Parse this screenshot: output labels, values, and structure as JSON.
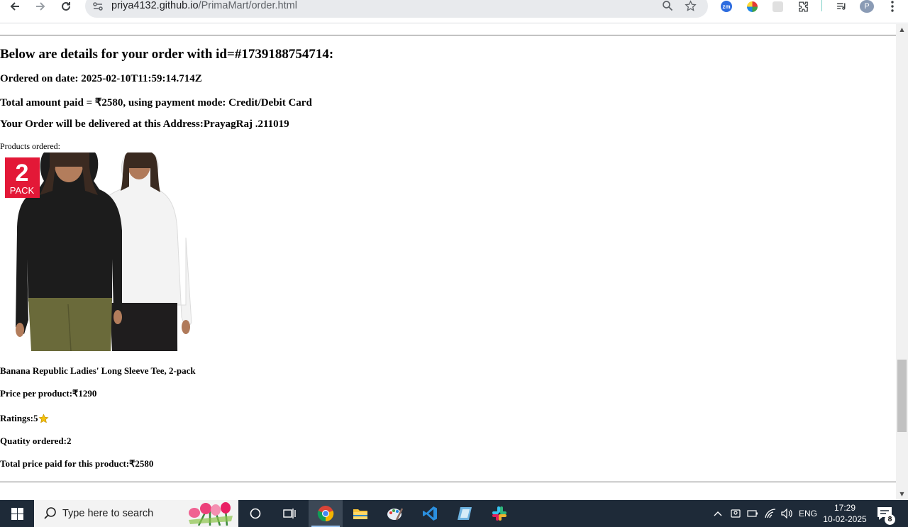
{
  "browser": {
    "url_host": "priya4132.github.io",
    "url_path": "/PrimaMart/order.html",
    "profile_initial": "P",
    "extensions": [
      "zoom-extension",
      "color-extension",
      "grey-extension",
      "extensions-puzzle"
    ]
  },
  "order": {
    "heading": "Below are details for your order with id=#1739188754714:",
    "ordered_on": "Ordered on date: 2025-02-10T11:59:14.714Z",
    "total_line": "Total amount paid = ₹2580, using payment mode: Credit/Debit Card",
    "address_line": "Your Order will be delivered at this Address:PrayagRaj .211019",
    "products_label": "Products ordered:"
  },
  "product": {
    "badge_number": "2",
    "badge_text": "PACK",
    "name": "Banana Republic Ladies' Long Sleeve Tee, 2-pack",
    "price": "Price per product:₹1290",
    "ratings_label": "Ratings:5",
    "quantity": "Quatity ordered:2",
    "total": "Total price paid for this product:₹2580"
  },
  "taskbar": {
    "search_placeholder": "Type here to search",
    "language": "ENG",
    "time": "17:29",
    "date": "10-02-2025",
    "notification_count": "8"
  },
  "colors": {
    "taskbar_bg": "#1e2a38",
    "badge_red": "#e31837",
    "star_gold": "#f4c20d"
  }
}
